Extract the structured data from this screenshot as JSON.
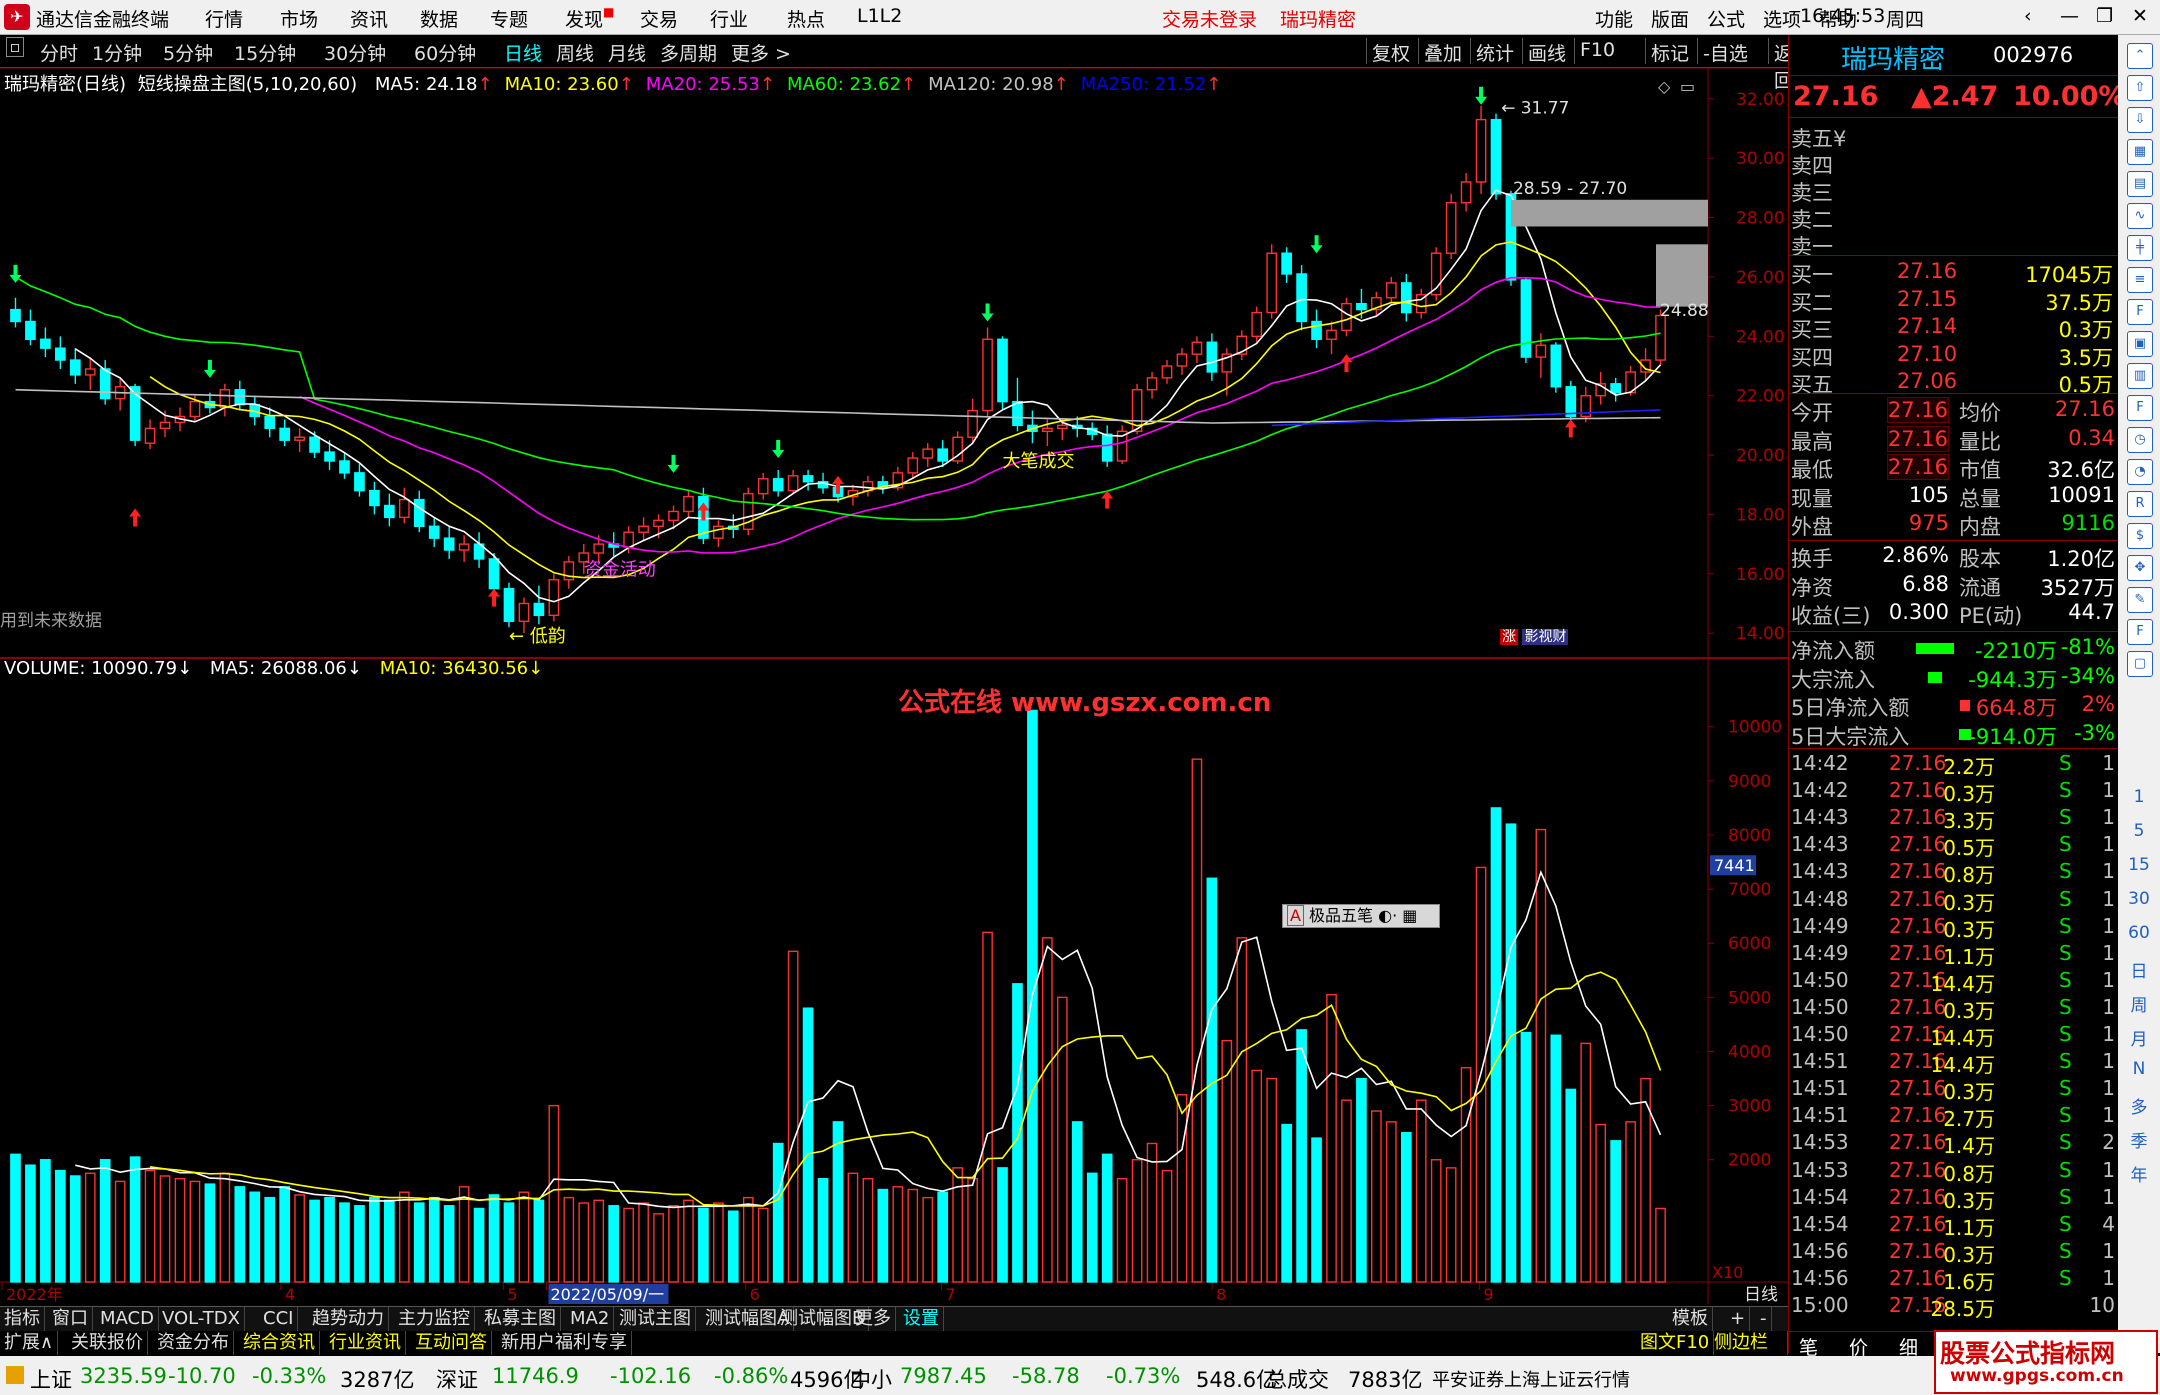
{
  "window": {
    "app_title": "通达信金融终端",
    "menus": [
      "行情",
      "市场",
      "资讯",
      "数据",
      "专题",
      "发现",
      "交易",
      "行业",
      "热点",
      "L1L2"
    ],
    "login_status": "交易未登录",
    "stock_title": "瑞玛精密",
    "right_menus": [
      "功能",
      "版面",
      "公式",
      "选项",
      "帮助"
    ],
    "time": "16:45:53",
    "weekday": "周四"
  },
  "toolbar": {
    "periods": [
      "分时",
      "1分钟",
      "5分钟",
      "15分钟",
      "30分钟",
      "60分钟",
      "日线",
      "周线",
      "月线",
      "多周期",
      "更多 >"
    ],
    "active_period": "日线",
    "right_buttons": [
      "复权",
      "叠加",
      "统计",
      "画线",
      "F10",
      "标记",
      "-自选",
      "返回"
    ]
  },
  "main_chart": {
    "header_name": "瑞玛精密(日线)",
    "indicator": "短线操盘主图(5,10,20,60)",
    "ma": [
      {
        "label": "MA5: 24.18",
        "arrow": "↑",
        "color": "#ffffff"
      },
      {
        "label": "MA10: 23.60",
        "arrow": "↑",
        "color": "#ffff00"
      },
      {
        "label": "MA20: 25.53",
        "arrow": "↑",
        "color": "#ff00ff"
      },
      {
        "label": "MA60: 23.62",
        "arrow": "↑",
        "color": "#00ff00"
      },
      {
        "label": "MA120: 20.98",
        "arrow": "↑",
        "color": "#c0c0c0"
      },
      {
        "label": "MA250: 21.52",
        "arrow": "↑",
        "color": "#0000ff"
      }
    ],
    "y_ticks": [
      "32.00",
      "30.00",
      "28.00",
      "26.00",
      "24.00",
      "22.00",
      "20.00",
      "18.00",
      "16.00",
      "14.00"
    ],
    "high_label": "31.77",
    "range_label": "28.59 - 27.70",
    "right_label": "24.88",
    "annotations": [
      "资金活动",
      "大笔成交",
      "低韵"
    ],
    "bottom_left_note": "用到未来数据",
    "badges": [
      "涨",
      "影视财"
    ]
  },
  "volume_chart": {
    "header": "VOLUME: 10090.79",
    "ma5": "MA5: 26088.06",
    "ma10": "MA10: 36430.56",
    "watermark": "公式在线  www.gszx.com.cn",
    "y_ticks": [
      "10000",
      "9000",
      "8000",
      "7000",
      "6000",
      "5000",
      "4000",
      "3000",
      "2000"
    ],
    "cursor_value": "7441",
    "unit_label": "X10",
    "popup_label": "极品五笔"
  },
  "x_axis": {
    "labels": [
      "2022年",
      "4",
      "5",
      "2022/05/09/一",
      "6",
      "7",
      "8",
      "9"
    ],
    "period_label": "日线"
  },
  "chart_data": {
    "type": "candlestick",
    "ohlc": [
      [
        24.9,
        25.3,
        24.3,
        24.5
      ],
      [
        24.5,
        24.9,
        23.7,
        23.9
      ],
      [
        23.9,
        24.3,
        23.3,
        23.6
      ],
      [
        23.6,
        24.0,
        22.9,
        23.2
      ],
      [
        23.2,
        23.6,
        22.4,
        22.7
      ],
      [
        22.7,
        23.3,
        22.2,
        22.9
      ],
      [
        22.9,
        23.2,
        21.7,
        21.9
      ],
      [
        21.9,
        22.6,
        21.5,
        22.3
      ],
      [
        22.3,
        22.4,
        20.3,
        20.5
      ],
      [
        20.4,
        21.2,
        20.2,
        20.9
      ],
      [
        20.9,
        21.5,
        20.6,
        21.1
      ],
      [
        21.1,
        21.6,
        20.8,
        21.3
      ],
      [
        21.3,
        22.0,
        21.1,
        21.8
      ],
      [
        21.8,
        22.1,
        21.4,
        21.6
      ],
      [
        21.6,
        22.4,
        21.3,
        22.2
      ],
      [
        22.2,
        22.5,
        21.5,
        21.7
      ],
      [
        21.7,
        22.0,
        21.0,
        21.3
      ],
      [
        21.3,
        21.6,
        20.6,
        20.9
      ],
      [
        20.9,
        21.2,
        20.3,
        20.5
      ],
      [
        20.5,
        20.9,
        20.1,
        20.6
      ],
      [
        20.6,
        20.8,
        19.9,
        20.1
      ],
      [
        20.1,
        20.5,
        19.5,
        19.8
      ],
      [
        19.8,
        20.1,
        19.2,
        19.4
      ],
      [
        19.4,
        19.7,
        18.6,
        18.8
      ],
      [
        18.8,
        19.1,
        18.0,
        18.3
      ],
      [
        18.3,
        18.7,
        17.6,
        17.9
      ],
      [
        17.9,
        18.9,
        17.7,
        18.5
      ],
      [
        18.5,
        18.8,
        17.4,
        17.6
      ],
      [
        17.6,
        17.9,
        16.9,
        17.2
      ],
      [
        17.2,
        17.6,
        16.5,
        16.8
      ],
      [
        16.8,
        17.3,
        16.4,
        17.0
      ],
      [
        17.0,
        17.4,
        16.2,
        16.5
      ],
      [
        16.5,
        16.7,
        15.3,
        15.5
      ],
      [
        15.5,
        15.7,
        14.2,
        14.4
      ],
      [
        14.4,
        15.2,
        14.0,
        15.0
      ],
      [
        15.0,
        15.6,
        14.3,
        14.6
      ],
      [
        14.6,
        16.0,
        14.4,
        15.8
      ],
      [
        15.8,
        16.6,
        15.5,
        16.4
      ],
      [
        16.4,
        17.0,
        16.0,
        16.7
      ],
      [
        16.7,
        17.3,
        16.4,
        17.0
      ],
      [
        17.0,
        17.4,
        16.6,
        16.9
      ],
      [
        16.9,
        17.6,
        16.7,
        17.4
      ],
      [
        17.4,
        17.9,
        17.1,
        17.6
      ],
      [
        17.6,
        18.0,
        17.2,
        17.8
      ],
      [
        17.8,
        18.3,
        17.5,
        18.1
      ],
      [
        18.1,
        18.8,
        17.9,
        18.6
      ],
      [
        18.6,
        18.9,
        17.0,
        17.2
      ],
      [
        17.2,
        17.8,
        16.9,
        17.6
      ],
      [
        17.6,
        18.0,
        17.2,
        17.5
      ],
      [
        17.5,
        18.9,
        17.3,
        18.7
      ],
      [
        18.7,
        19.4,
        18.5,
        19.2
      ],
      [
        19.2,
        19.5,
        18.6,
        18.8
      ],
      [
        18.8,
        19.5,
        18.7,
        19.3
      ],
      [
        19.3,
        19.5,
        18.8,
        19.1
      ],
      [
        19.1,
        19.4,
        18.7,
        18.9
      ],
      [
        18.9,
        19.1,
        18.4,
        18.6
      ],
      [
        18.6,
        19.0,
        18.3,
        18.8
      ],
      [
        18.8,
        19.3,
        18.6,
        19.1
      ],
      [
        19.1,
        19.3,
        18.7,
        18.9
      ],
      [
        18.9,
        19.6,
        18.8,
        19.4
      ],
      [
        19.4,
        20.1,
        19.2,
        19.9
      ],
      [
        19.9,
        20.4,
        19.6,
        20.2
      ],
      [
        20.2,
        20.5,
        19.6,
        19.8
      ],
      [
        19.8,
        20.8,
        19.7,
        20.6
      ],
      [
        20.6,
        21.9,
        20.4,
        21.5
      ],
      [
        21.5,
        24.3,
        21.3,
        23.9
      ],
      [
        23.9,
        24.0,
        21.5,
        21.8
      ],
      [
        21.8,
        22.6,
        20.8,
        21.0
      ],
      [
        21.0,
        21.5,
        20.4,
        20.8
      ],
      [
        20.8,
        21.2,
        20.3,
        20.9
      ],
      [
        20.9,
        21.2,
        20.5,
        21.0
      ],
      [
        21.0,
        21.3,
        20.6,
        20.9
      ],
      [
        20.9,
        21.1,
        20.5,
        20.7
      ],
      [
        20.7,
        21.0,
        19.6,
        19.8
      ],
      [
        19.8,
        21.0,
        19.7,
        20.8
      ],
      [
        20.8,
        22.4,
        20.7,
        22.2
      ],
      [
        22.2,
        22.8,
        21.9,
        22.6
      ],
      [
        22.6,
        23.2,
        22.4,
        23.0
      ],
      [
        23.0,
        23.6,
        22.7,
        23.4
      ],
      [
        23.4,
        24.0,
        23.1,
        23.8
      ],
      [
        23.8,
        24.1,
        22.5,
        22.8
      ],
      [
        22.8,
        23.6,
        22.0,
        23.4
      ],
      [
        23.4,
        24.2,
        23.2,
        24.0
      ],
      [
        24.0,
        25.0,
        23.8,
        24.8
      ],
      [
        24.8,
        27.1,
        24.6,
        26.8
      ],
      [
        26.8,
        27.0,
        25.8,
        26.1
      ],
      [
        26.1,
        26.4,
        24.2,
        24.5
      ],
      [
        24.5,
        24.9,
        23.6,
        23.9
      ],
      [
        23.9,
        24.5,
        23.4,
        24.2
      ],
      [
        24.2,
        25.3,
        24.0,
        25.1
      ],
      [
        25.1,
        25.6,
        24.6,
        24.9
      ],
      [
        24.9,
        25.5,
        24.7,
        25.3
      ],
      [
        25.3,
        26.0,
        25.1,
        25.8
      ],
      [
        25.8,
        26.1,
        24.5,
        24.8
      ],
      [
        24.8,
        25.6,
        24.6,
        25.4
      ],
      [
        25.4,
        27.0,
        25.2,
        26.8
      ],
      [
        26.8,
        28.8,
        26.6,
        28.5
      ],
      [
        28.5,
        29.5,
        28.2,
        29.2
      ],
      [
        29.2,
        31.77,
        28.8,
        31.3
      ],
      [
        31.3,
        31.5,
        28.6,
        28.8
      ],
      [
        28.8,
        28.9,
        25.7,
        25.9
      ],
      [
        25.9,
        26.0,
        23.1,
        23.3
      ],
      [
        23.3,
        24.1,
        22.6,
        23.7
      ],
      [
        23.7,
        23.8,
        22.1,
        22.3
      ],
      [
        22.3,
        22.5,
        21.1,
        21.3
      ],
      [
        21.3,
        22.3,
        21.1,
        22.0
      ],
      [
        22.0,
        22.8,
        21.7,
        22.4
      ],
      [
        22.4,
        22.6,
        21.8,
        22.1
      ],
      [
        22.1,
        23.0,
        22.0,
        22.8
      ],
      [
        22.8,
        23.6,
        22.5,
        23.2
      ],
      [
        23.2,
        24.9,
        23.0,
        24.7
      ]
    ],
    "volume": [
      2100,
      1900,
      2000,
      1800,
      1700,
      1750,
      2000,
      1600,
      2050,
      1800,
      1700,
      1650,
      1600,
      1550,
      1750,
      1500,
      1400,
      1300,
      1500,
      1350,
      1250,
      1300,
      1200,
      1150,
      1300,
      1250,
      1400,
      1200,
      1300,
      1150,
      1500,
      1100,
      1350,
      1200,
      1400,
      1250,
      3000,
      1300,
      1200,
      1250,
      1150,
      1100,
      1200,
      1000,
      1150,
      1250,
      1100,
      1200,
      1050,
      1300,
      1100,
      2300,
      5850,
      4800,
      1650,
      2700,
      1750,
      1650,
      1450,
      1500,
      1450,
      1300,
      1400,
      1850,
      1650,
      6200,
      1850,
      5250,
      10300,
      6100,
      5000,
      2700,
      1750,
      2100,
      1650,
      2000,
      2300,
      1800,
      3200,
      9400,
      7200,
      4200,
      6100,
      3650,
      3500,
      2650,
      4400,
      2400,
      5050,
      3100,
      3500,
      2900,
      2700,
      2500,
      3100,
      2000,
      1850,
      3700,
      7400,
      8500,
      8200,
      4350,
      8100,
      4300,
      3300,
      4150,
      2650,
      2350,
      2700,
      3500,
      1100
    ],
    "ylim": [
      13.5,
      32.5
    ],
    "x_labels": [
      "2022年",
      "4",
      "5",
      "2022/05/09/一",
      "6",
      "7",
      "8",
      "9"
    ]
  },
  "quote": {
    "name": "瑞玛精密",
    "code": "002976",
    "price": "27.16",
    "change": "▲2.47",
    "pct": "10.00%",
    "sell": [
      "卖五",
      "卖四",
      "卖三",
      "卖二",
      "卖一"
    ],
    "sell_unit": "¥",
    "buy": [
      {
        "label": "买一",
        "price": "27.16",
        "vol": "17045万"
      },
      {
        "label": "买二",
        "price": "27.15",
        "vol": "37.5万"
      },
      {
        "label": "买三",
        "price": "27.14",
        "vol": "0.3万"
      },
      {
        "label": "买四",
        "price": "27.10",
        "vol": "3.5万"
      },
      {
        "label": "买五",
        "price": "27.06",
        "vol": "0.5万"
      }
    ],
    "stats": [
      {
        "l1": "今开",
        "v1": "27.16",
        "l2": "均价",
        "v2": "27.16"
      },
      {
        "l1": "最高",
        "v1": "27.16",
        "l2": "量比",
        "v2": "0.34"
      },
      {
        "l1": "最低",
        "v1": "27.16",
        "l2": "市值",
        "v2": "32.6亿"
      },
      {
        "l1": "现量",
        "v1": "105",
        "l2": "总量",
        "v2": "10091"
      },
      {
        "l1": "外盘",
        "v1": "975",
        "l2": "内盘",
        "v2": "9116"
      }
    ],
    "stats2": [
      {
        "l1": "换手",
        "v1": "2.86%",
        "l2": "股本",
        "v2": "1.20亿"
      },
      {
        "l1": "净资",
        "v1": "6.88",
        "l2": "流通",
        "v2": "3527万"
      },
      {
        "l1": "收益(三)",
        "v1": "0.300",
        "l2": "PE(动)",
        "v2": "44.7"
      }
    ],
    "flows": [
      {
        "label": "净流入额",
        "value": "-2210万",
        "pct": "-81%",
        "color": "#00ff00"
      },
      {
        "label": "大宗流入",
        "value": "-944.3万",
        "pct": "-34%",
        "color": "#00ff00"
      },
      {
        "label": "5日净流入额",
        "value": "664.8万",
        "pct": "2%",
        "color": "#ff3030"
      },
      {
        "label": "5日大宗流入",
        "value": "-914.0万",
        "pct": "-3%",
        "color": "#00ff00"
      }
    ],
    "ticks": [
      {
        "t": "14:42",
        "p": "27.16",
        "v": "2.2万",
        "s": "S",
        "n": "1"
      },
      {
        "t": "14:42",
        "p": "27.16",
        "v": "0.3万",
        "s": "S",
        "n": "1"
      },
      {
        "t": "14:43",
        "p": "27.16",
        "v": "3.3万",
        "s": "S",
        "n": "1"
      },
      {
        "t": "14:43",
        "p": "27.16",
        "v": "0.5万",
        "s": "S",
        "n": "1"
      },
      {
        "t": "14:43",
        "p": "27.16",
        "v": "0.8万",
        "s": "S",
        "n": "1"
      },
      {
        "t": "14:48",
        "p": "27.16",
        "v": "0.3万",
        "s": "S",
        "n": "1"
      },
      {
        "t": "14:49",
        "p": "27.16",
        "v": "0.3万",
        "s": "S",
        "n": "1"
      },
      {
        "t": "14:49",
        "p": "27.16",
        "v": "1.1万",
        "s": "S",
        "n": "1"
      },
      {
        "t": "14:50",
        "p": "27.16",
        "v": "14.4万",
        "s": "S",
        "n": "1"
      },
      {
        "t": "14:50",
        "p": "27.16",
        "v": "0.3万",
        "s": "S",
        "n": "1"
      },
      {
        "t": "14:50",
        "p": "27.16",
        "v": "14.4万",
        "s": "S",
        "n": "1"
      },
      {
        "t": "14:51",
        "p": "27.16",
        "v": "14.4万",
        "s": "S",
        "n": "1"
      },
      {
        "t": "14:51",
        "p": "27.16",
        "v": "0.3万",
        "s": "S",
        "n": "1"
      },
      {
        "t": "14:51",
        "p": "27.16",
        "v": "2.7万",
        "s": "S",
        "n": "1"
      },
      {
        "t": "14:53",
        "p": "27.16",
        "v": "1.4万",
        "s": "S",
        "n": "2"
      },
      {
        "t": "14:53",
        "p": "27.16",
        "v": "0.8万",
        "s": "S",
        "n": "1"
      },
      {
        "t": "14:54",
        "p": "27.16",
        "v": "0.3万",
        "s": "S",
        "n": "1"
      },
      {
        "t": "14:54",
        "p": "27.16",
        "v": "1.1万",
        "s": "S",
        "n": "4"
      },
      {
        "t": "14:56",
        "p": "27.16",
        "v": "0.3万",
        "s": "S",
        "n": "1"
      },
      {
        "t": "14:56",
        "p": "27.16",
        "v": "1.6万",
        "s": "S",
        "n": "1"
      },
      {
        "t": "15:00",
        "p": "27.16",
        "v": "28.5万",
        "s": "",
        "n": "10"
      }
    ],
    "panel_tabs": [
      "笔",
      "价",
      "细",
      "势"
    ]
  },
  "side_strip": [
    "1",
    "5",
    "15",
    "30",
    "60",
    "日",
    "周",
    "月",
    "N",
    "多",
    "季",
    "年"
  ],
  "bottom_tabs": [
    "指标",
    "窗口",
    "MACD",
    "VOL-TDX",
    "CCI",
    "趋势动力",
    "主力监控",
    "私募主图",
    "MA2",
    "测试主图",
    "测试幅图A",
    "测试幅图B",
    "更多",
    "设置"
  ],
  "bottom_right": [
    "模板",
    "+",
    "-"
  ],
  "bottom_tabs2": [
    "扩展∧",
    "关联报价",
    "资金分布",
    "综合资讯",
    "行业资讯",
    "互动问答",
    "新用户福利专享"
  ],
  "bottom_tabs2_right": [
    "图文F10",
    "侧边栏《"
  ],
  "status_bar": [
    {
      "label": "上证",
      "value": "3235.59",
      "chg": "-10.70",
      "pct": "-0.33%",
      "amt": "3287亿"
    },
    {
      "label": "深证",
      "value": "11746.9",
      "chg": "-102.16",
      "pct": "-0.86%",
      "amt": "4596亿"
    },
    {
      "label": "中小",
      "value": "7987.45",
      "chg": "-58.78",
      "pct": "-0.73%",
      "amt": "548.6亿"
    }
  ],
  "status_total": {
    "label": "总成交",
    "value": "7883亿"
  },
  "status_broker": "平安证券上海上证云行情",
  "watermark_site": "股票公式指标网",
  "watermark_url": "www.gpgs.com.cn"
}
